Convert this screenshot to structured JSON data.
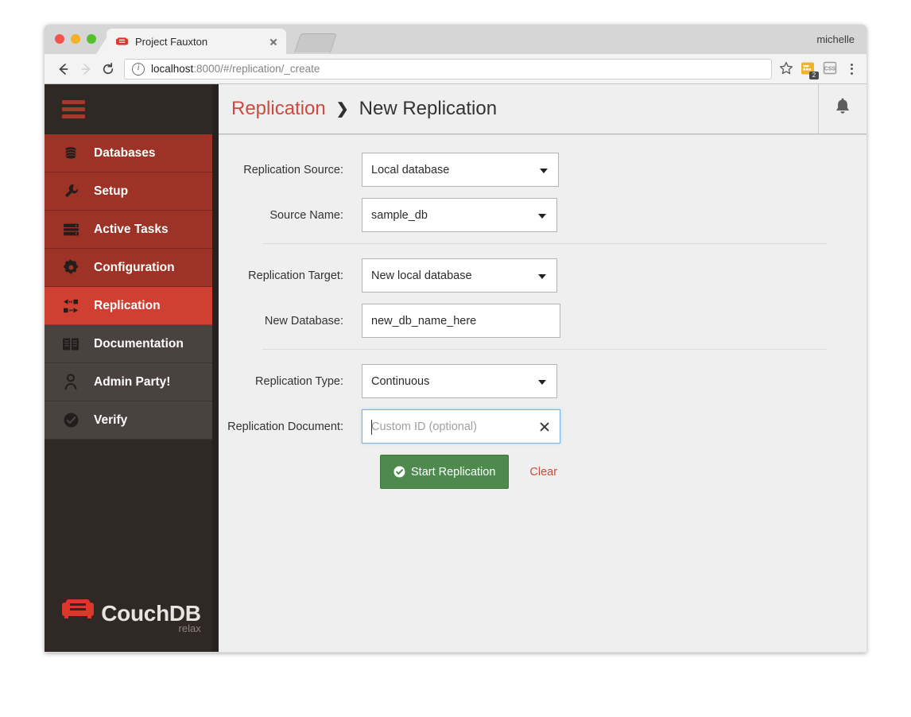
{
  "browser": {
    "window_controls": [
      "close",
      "minimize",
      "maximize"
    ],
    "tab": {
      "title": "Project Fauxton",
      "favicon": "couch-icon",
      "close_label": "×"
    },
    "new_tab_label": "+",
    "profile_name": "michelle",
    "toolbar": {
      "back_label": "←",
      "forward_label": "→",
      "reload_label": "⟳",
      "url_host": "localhost",
      "url_rest": ":8000/#/replication/_create",
      "info_icon": "info-icon",
      "star_icon": "star-icon",
      "extension_badge": "2",
      "extension_css_label": "CSS",
      "menu_label": "⋮"
    }
  },
  "sidebar": {
    "menu_toggle": "hamburger-icon",
    "items": [
      {
        "label": "Databases",
        "icon": "database-icon",
        "style": "red"
      },
      {
        "label": "Setup",
        "icon": "wrench-icon",
        "style": "red"
      },
      {
        "label": "Active Tasks",
        "icon": "tasks-icon",
        "style": "red"
      },
      {
        "label": "Configuration",
        "icon": "gear-icon",
        "style": "red"
      },
      {
        "label": "Replication",
        "icon": "replication-icon",
        "style": "active"
      },
      {
        "label": "Documentation",
        "icon": "book-icon",
        "style": "gray"
      },
      {
        "label": "Admin Party!",
        "icon": "user-icon",
        "style": "gray"
      },
      {
        "label": "Verify",
        "icon": "check-circle-icon",
        "style": "gray"
      }
    ],
    "logo": {
      "name": "CouchDB",
      "tagline": "relax",
      "icon": "couch-icon"
    }
  },
  "header": {
    "breadcrumb_link": "Replication",
    "breadcrumb_separator": "❯",
    "breadcrumb_current": "New Replication",
    "bell_icon": "bell-icon"
  },
  "form": {
    "fields": [
      {
        "label": "Replication Source:",
        "value": "Local database",
        "type": "select"
      },
      {
        "label": "Source Name:",
        "value": "sample_db",
        "type": "select"
      },
      {
        "label": "Replication Target:",
        "value": "New local database",
        "type": "select"
      },
      {
        "label": "New Database:",
        "value": "new_db_name_here",
        "type": "text"
      },
      {
        "label": "Replication Type:",
        "value": "Continuous",
        "type": "select"
      },
      {
        "label": "Replication Document:",
        "value": "",
        "placeholder": "Custom ID (optional)",
        "type": "text",
        "focused": true,
        "clearable": true
      }
    ],
    "submit_label": "Start Replication",
    "clear_label": "Clear"
  },
  "colors": {
    "brand_red": "#cc4b41",
    "sidebar_red": "#9c3326",
    "sidebar_active_red": "#cf4032",
    "sidebar_dark": "#2f2825",
    "sidebar_gray": "#4a423f",
    "submit_green": "#4e8a4e",
    "focus_blue": "#7cb4e8"
  }
}
